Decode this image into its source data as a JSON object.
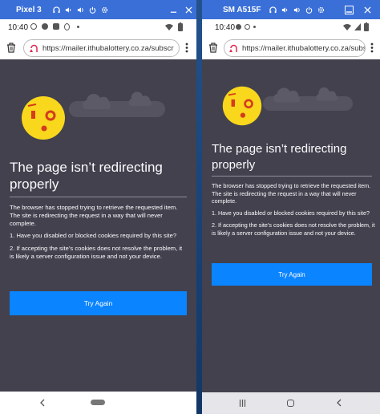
{
  "devices": [
    {
      "window_title": "Pixel 3",
      "status_time": "10:40",
      "url": "https://mailer.ithubalottery.co.za/subscr",
      "error_title_line1": "The page isn’t redirecting",
      "error_title_line2": "properly",
      "error_desc": "The browser has stopped trying to retrieve the requested item. The site is redirecting the request in a way that will never complete.",
      "item1": "1. Have you disabled or blocked cookies required by this site?",
      "item2": "2. If accepting the site’s cookies does not resolve the problem, it is likely a server configuration issue and not your device.",
      "button": "Try Again"
    },
    {
      "window_title": "SM A515F",
      "status_time": "10:40",
      "url": "https://mailer.ithubalottery.co.za/subsc",
      "error_title_line1": "The page isn’t redirecting",
      "error_title_line2": "properly",
      "error_desc": "The browser has stopped trying to retrieve the requested item. The site is redirecting the request in a way that will never complete.",
      "item1": "1. Have you disabled or blocked cookies required by this site?",
      "item2": "2. If accepting the site’s cookies does not resolve the problem, it is likely a server configuration issue and not your device.",
      "button": "Try Again"
    }
  ],
  "colors": {
    "window_bar": "#3a6fd8",
    "page_bg": "#42414d",
    "button": "#0a84ff",
    "face": "#f9d71c"
  }
}
